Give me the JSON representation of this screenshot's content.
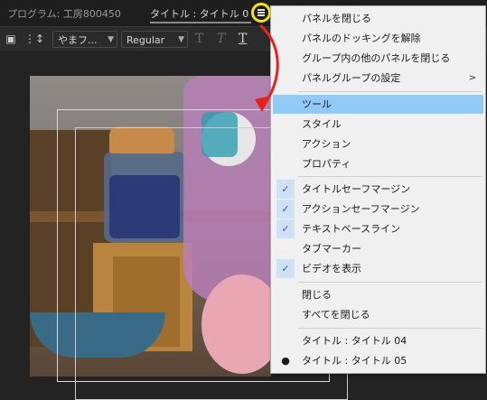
{
  "header": {
    "program_label": "プログラム: 工房800450",
    "title_tab": "タイトル : タイトル 05"
  },
  "toolbar": {
    "font_name": "やまフ...",
    "font_style": "Regular",
    "t_labels": [
      "T",
      "T",
      "T"
    ]
  },
  "panel_menu": {
    "items": [
      {
        "label": "パネルを閉じる"
      },
      {
        "label": "パネルのドッキングを解除"
      },
      {
        "label": "グループ内の他のパネルを閉じる"
      },
      {
        "label": "パネルグループの設定",
        "submenu": ">"
      },
      {
        "label": "ツール"
      },
      {
        "label": "スタイル"
      },
      {
        "label": "アクション"
      },
      {
        "label": "プロパティ"
      },
      {
        "label": "タイトルセーフマージン",
        "checked": true
      },
      {
        "label": "アクションセーフマージン",
        "checked": true
      },
      {
        "label": "テキストベースライン",
        "checked": true
      },
      {
        "label": "タブマーカー"
      },
      {
        "label": "ビデオを表示",
        "checked": true
      },
      {
        "label": "閉じる"
      },
      {
        "label": "すべてを閉じる"
      },
      {
        "label": "タイトル : タイトル 04"
      },
      {
        "label": "タイトル : タイトル 05",
        "selected": true
      }
    ],
    "check_mark": "✓",
    "bullet": "●"
  },
  "colors": {
    "highlight": "#91c9f7",
    "annotation_circle": "#f3e31a",
    "annotation_arrow": "#e8221b"
  },
  "icons": [
    "menu-icon",
    "chevron-down-icon",
    "checkmark-icon"
  ]
}
